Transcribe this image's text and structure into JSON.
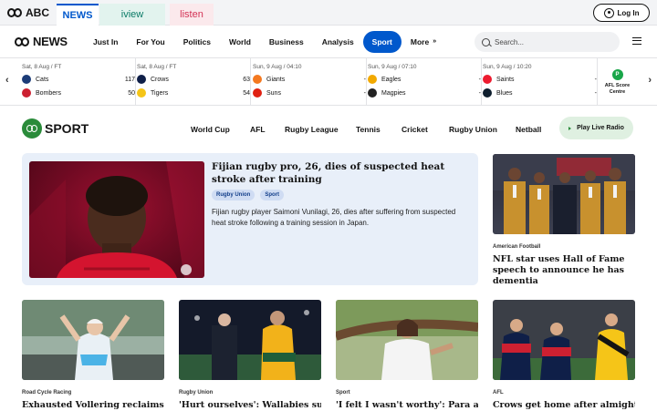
{
  "network": {
    "logo": "ABC",
    "tabs": {
      "news": "NEWS",
      "iview": "iview",
      "listen": "listen"
    },
    "login_label": "Log In"
  },
  "nav": {
    "logo": "NEWS",
    "items": [
      "Just In",
      "For You",
      "Politics",
      "World",
      "Business",
      "Analysis",
      "Sport",
      "More"
    ],
    "active": "Sport",
    "search_placeholder": "Search..."
  },
  "scores": [
    {
      "date": "Sat, 8 Aug",
      "status": "FT",
      "teams": [
        {
          "name": "Cats",
          "score": "117",
          "color": "#1c3c78"
        },
        {
          "name": "Bombers",
          "score": "50",
          "color": "#cc2031"
        }
      ]
    },
    {
      "date": "Sat, 8 Aug",
      "status": "FT",
      "teams": [
        {
          "name": "Crows",
          "score": "63",
          "color": "#0f1f48"
        },
        {
          "name": "Tigers",
          "score": "54",
          "color": "#f5c518"
        }
      ]
    },
    {
      "date": "Sun, 9 Aug",
      "status": "04:10",
      "teams": [
        {
          "name": "Giants",
          "score": "-",
          "color": "#f47920"
        },
        {
          "name": "Suns",
          "score": "-",
          "color": "#e02112"
        }
      ]
    },
    {
      "date": "Sun, 9 Aug",
      "status": "07:10",
      "teams": [
        {
          "name": "Eagles",
          "score": "-",
          "color": "#f2a900"
        },
        {
          "name": "Magpies",
          "score": "-",
          "color": "#222222"
        }
      ]
    },
    {
      "date": "Sun, 9 Aug",
      "status": "10:20",
      "teams": [
        {
          "name": "Saints",
          "score": "-",
          "color": "#ed1b2f"
        },
        {
          "name": "Blues",
          "score": "-",
          "color": "#0e1e2d"
        }
      ]
    }
  ],
  "afl_centre": {
    "line1": "AFL Score",
    "line2": "Centre"
  },
  "sport": {
    "logo": "SPORT",
    "links": [
      "World Cup",
      "AFL",
      "Rugby League",
      "Tennis",
      "Cricket",
      "Rugby Union",
      "Netball"
    ],
    "radio_label": "Play Live Radio"
  },
  "feature": {
    "title": "Fijian rugby pro, 26, dies of suspected heat stroke after training",
    "tags": [
      "Rugby Union",
      "Sport"
    ],
    "summary": "Fijian rugby player Saimoni Vunilagi, 26, dies after suffering from suspected heat stroke following a training session in Japan."
  },
  "side_story": {
    "category": "American Football",
    "title": "NFL star uses Hall of Fame speech to announce he has dementia"
  },
  "cards": [
    {
      "category": "Road Cycle Racing",
      "title": "Exhausted Vollering reclaims"
    },
    {
      "category": "Rugby Union",
      "title": "'Hurt ourselves': Wallabies survive"
    },
    {
      "category": "Sport",
      "title": "'I felt I wasn't worthy': Para athletes"
    },
    {
      "category": "AFL",
      "title": "Crows get home after almighty"
    }
  ],
  "colors": {
    "accent": "#0058cc",
    "sport_green": "#2a8b3a",
    "feature_bg": "#e8eff9"
  }
}
